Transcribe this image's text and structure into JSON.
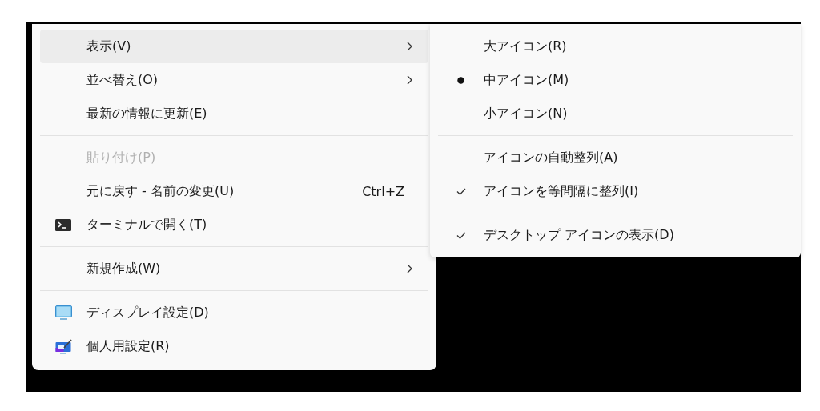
{
  "context_menu": {
    "groups": [
      [
        {
          "label": "表示(V)",
          "submenu": true,
          "selected": true,
          "disabled": false
        },
        {
          "label": "並べ替え(O)",
          "submenu": true,
          "selected": false,
          "disabled": false
        },
        {
          "label": "最新の情報に更新(E)",
          "submenu": false,
          "selected": false,
          "disabled": false
        }
      ],
      [
        {
          "label": "貼り付け(P)",
          "submenu": false,
          "selected": false,
          "disabled": true
        },
        {
          "label": "元に戻す - 名前の変更(U)",
          "shortcut": "Ctrl+Z",
          "submenu": false,
          "selected": false,
          "disabled": false
        },
        {
          "label": "ターミナルで開く(T)",
          "submenu": false,
          "selected": false,
          "disabled": false
        }
      ],
      [
        {
          "label": "新規作成(W)",
          "submenu": true,
          "selected": false,
          "disabled": false
        }
      ],
      [
        {
          "label": "ディスプレイ設定(D)",
          "submenu": false,
          "selected": false,
          "disabled": false
        },
        {
          "label": "個人用設定(R)",
          "submenu": false,
          "selected": false,
          "disabled": false
        }
      ]
    ]
  },
  "view_submenu": {
    "groups": [
      [
        {
          "label": "大アイコン(R)",
          "kind": "radio",
          "checked": false
        },
        {
          "label": "中アイコン(M)",
          "kind": "radio",
          "checked": true
        },
        {
          "label": "小アイコン(N)",
          "kind": "radio",
          "checked": false
        }
      ],
      [
        {
          "label": "アイコンの自動整列(A)",
          "kind": "check",
          "checked": false
        },
        {
          "label": "アイコンを等間隔に整列(I)",
          "kind": "check",
          "checked": true
        }
      ],
      [
        {
          "label": "デスクトップ アイコンの表示(D)",
          "kind": "check",
          "checked": true
        }
      ]
    ]
  }
}
